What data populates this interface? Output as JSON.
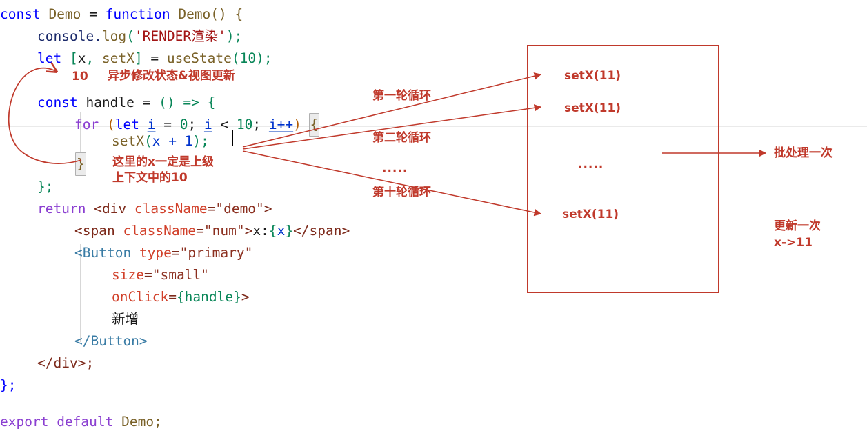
{
  "editor": {
    "language": "jsx",
    "code_lines": [
      {
        "line": 1,
        "indent": 0,
        "text": "const Demo = function Demo() {"
      },
      {
        "line": 2,
        "indent": 1,
        "text": "console.log('RENDER渲染');"
      },
      {
        "line": 3,
        "indent": 1,
        "text": "let [x, setX] = useState(10);"
      },
      {
        "line": 4,
        "indent": 1,
        "text": "const handle = () => {"
      },
      {
        "line": 5,
        "indent": 2,
        "text": "for (let i = 0; i < 10; i++) {"
      },
      {
        "line": 6,
        "indent": 3,
        "text": "setX(x + 1);"
      },
      {
        "line": 7,
        "indent": 2,
        "text": "}"
      },
      {
        "line": 8,
        "indent": 1,
        "text": "};"
      },
      {
        "line": 9,
        "indent": 1,
        "text": "return <div className=\"demo\">"
      },
      {
        "line": 10,
        "indent": 2,
        "text": "<span className=\"num\">x:{x}</span>"
      },
      {
        "line": 11,
        "indent": 2,
        "text": "<Button type=\"primary\""
      },
      {
        "line": 12,
        "indent": 3,
        "text": "size=\"small\""
      },
      {
        "line": 13,
        "indent": 3,
        "text": "onClick={handle}>"
      },
      {
        "line": 14,
        "indent": 3,
        "text": "新增"
      },
      {
        "line": 15,
        "indent": 2,
        "text": "</Button>"
      },
      {
        "line": 16,
        "indent": 1,
        "text": "</div>;"
      },
      {
        "line": 17,
        "indent": 0,
        "text": "};"
      },
      {
        "line": 18,
        "indent": 0,
        "text": ""
      },
      {
        "line": 19,
        "indent": 0,
        "text": "export default Demo;"
      }
    ],
    "tokens": {
      "const": "const",
      "demo_name": "Demo",
      "equals": " = ",
      "function_kw": "function",
      "demo_fn": "Demo() {",
      "console": "console",
      "dot": ".",
      "log": "log",
      "paren_open": "(",
      "render_string": "'RENDER渲染'",
      "paren_close_semi": ");",
      "let": "let",
      "bracket_open": "[",
      "x_var": "x",
      "comma": ", ",
      "setX": "setX",
      "bracket_close": "]",
      "useState": "useState",
      "ten": "10",
      "handle": "handle",
      "arrow_fn": "() => {",
      "for": "for",
      "i_var": "i",
      "zero": "0",
      "lt": " < ",
      "i_inc": "i++",
      "setX_call": "setX",
      "x_plus_1": "x + 1",
      "close_brace": "}",
      "close_brace_semi": "};",
      "return": "return",
      "div_open": "<div",
      "className": "className",
      "demo_class": "\"demo\"",
      "gt": ">",
      "span_open": "<span",
      "num_class": "\"num\"",
      "x_label": "x:",
      "brace_open": "{",
      "brace_close": "}",
      "span_close": "</span>",
      "button_open": "<Button",
      "type_attr": "type",
      "primary_value": "\"primary\"",
      "size_attr": "size",
      "small_value": "\"small\"",
      "onClick_attr": "onClick",
      "handle_expr": "{handle}",
      "button_text": "新增",
      "button_close": "</Button>",
      "div_close": "</div>;",
      "export": "export",
      "default": "default",
      "demo_export": "Demo;"
    },
    "colors": {
      "keyword_blue": "#0000ff",
      "keyword_purple": "#8b3fd1",
      "identifier_gold": "#7a6229",
      "object_navy": "#1b2a6b",
      "string_red": "#a31515",
      "number_green": "#098658",
      "variable_blue": "#0033cc",
      "jsx_tag": "#7d2a1b",
      "jsx_component": "#3a7ca5",
      "jsx_attribute": "#d1402a",
      "paren_brown": "#b45f06",
      "background": "#ffffff",
      "active_line_border": "#eaeaea",
      "indent_guide": "#d7d7d7",
      "bracket_match_border": "#b0b0b0"
    }
  },
  "annotations": {
    "accent_color": "#c0392b",
    "state_value": "10",
    "async_note": "异步修改状态&视图更新",
    "x_note_line1": "这里的x一定是上级",
    "x_note_line2": "上下文中的10",
    "loop_1": "第一轮循环",
    "loop_2": "第二轮循环",
    "loop_10": "第十轮循环",
    "ellipsis_left": ".....",
    "ellipsis_box": ".....",
    "batch_note": "批处理一次",
    "update_note_line1": "更新一次",
    "update_note_line2": "x->11",
    "queue_items": [
      {
        "label": "setX(11)"
      },
      {
        "label": "setX(11)"
      },
      {
        "label": "setX(11)"
      }
    ]
  }
}
